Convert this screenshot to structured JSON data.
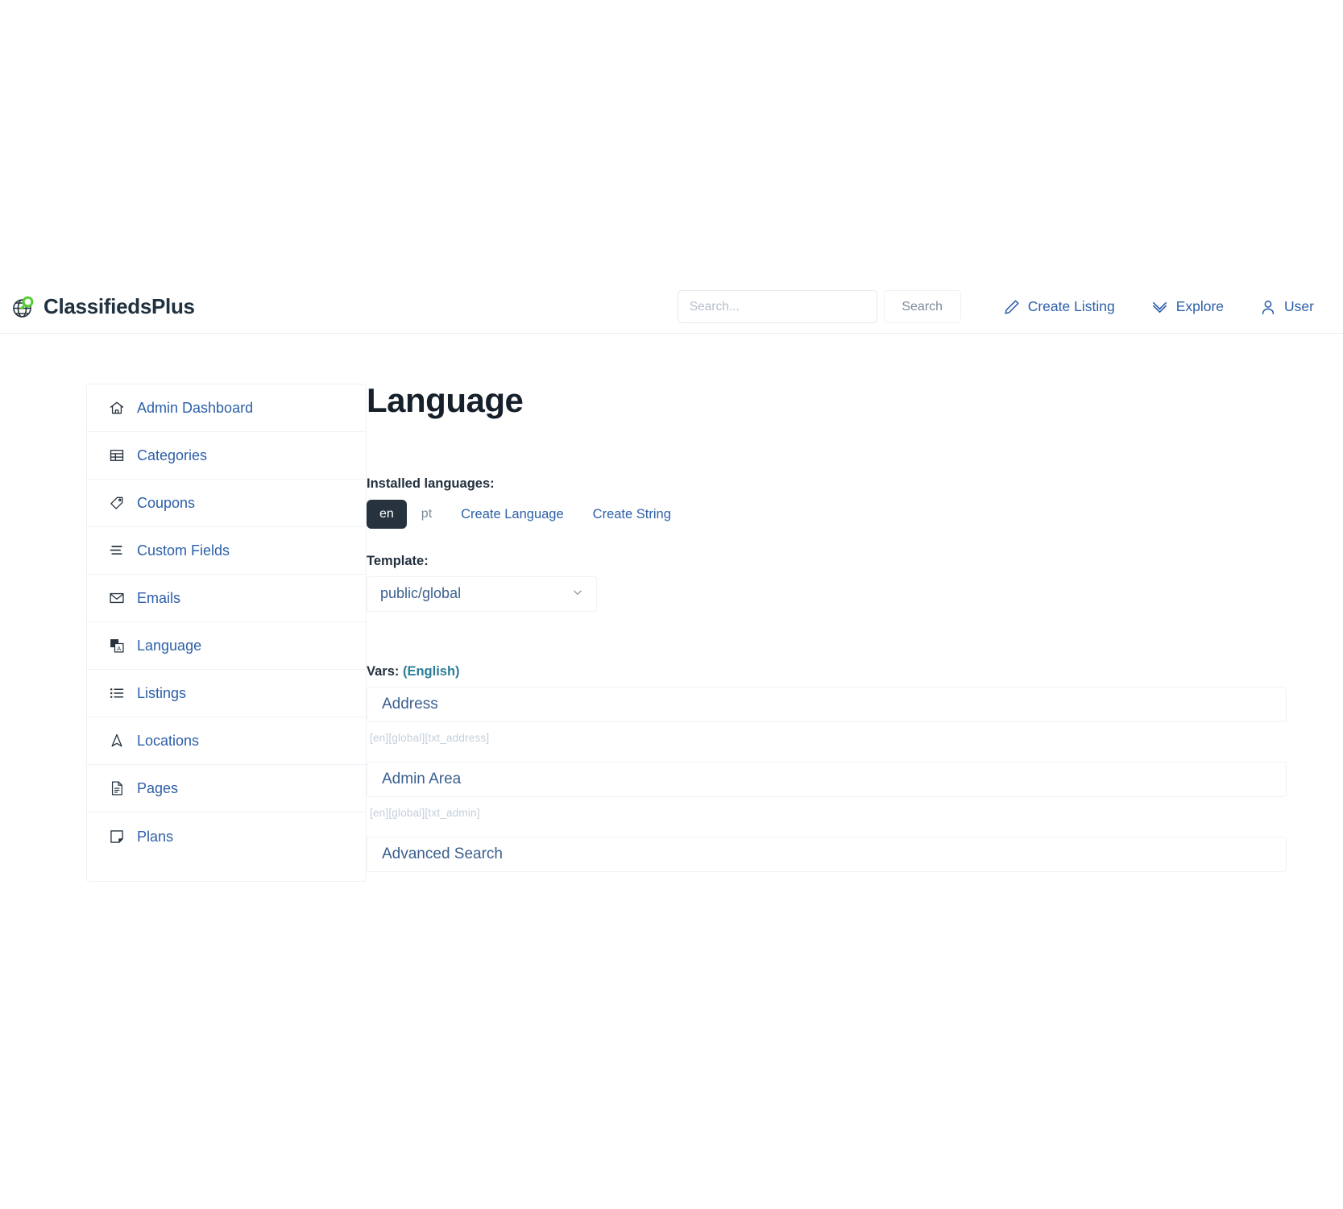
{
  "header": {
    "brand_name": "ClassifiedsPlus",
    "brand_logo_icon": "globe-search-icon",
    "search": {
      "value": "",
      "placeholder": "Search...",
      "button_label": "Search"
    },
    "nav": [
      {
        "label": "Create Listing",
        "icon": "pencil-icon"
      },
      {
        "label": "Explore",
        "icon": "double-chevron-down-icon"
      },
      {
        "label": "User",
        "icon": "user-icon"
      }
    ]
  },
  "sidebar": {
    "items": [
      {
        "label": "Admin Dashboard",
        "icon": "home-icon"
      },
      {
        "label": "Categories",
        "icon": "table-icon"
      },
      {
        "label": "Coupons",
        "icon": "tag-icon"
      },
      {
        "label": "Custom Fields",
        "icon": "form-lines-icon"
      },
      {
        "label": "Emails",
        "icon": "envelope-icon"
      },
      {
        "label": "Language",
        "icon": "translate-icon"
      },
      {
        "label": "Listings",
        "icon": "list-icon"
      },
      {
        "label": "Locations",
        "icon": "navigation-arrow-icon"
      },
      {
        "label": "Pages",
        "icon": "document-icon"
      },
      {
        "label": "Plans",
        "icon": "note-icon"
      }
    ]
  },
  "main": {
    "title": "Language",
    "installed_languages_label": "Installed languages:",
    "languages": [
      {
        "code": "en",
        "active": true
      },
      {
        "code": "pt",
        "active": false
      }
    ],
    "language_actions": [
      {
        "label": "Create Language"
      },
      {
        "label": "Create String"
      }
    ],
    "template_label": "Template:",
    "template_value": "public/global",
    "template_chevron": "chevron-down-icon",
    "vars_label": "Vars:",
    "vars_language": "(English)",
    "vars": [
      {
        "value": "Address",
        "key": "[en][global][txt_address]"
      },
      {
        "value": "Admin Area",
        "key": "[en][global][txt_admin]"
      },
      {
        "value": "Advanced Search",
        "key": ""
      }
    ]
  },
  "colors": {
    "link_blue": "#2d5fa8",
    "accent_green": "#55cc33",
    "dark_navy": "#26333f",
    "border": "#eef2f6"
  }
}
